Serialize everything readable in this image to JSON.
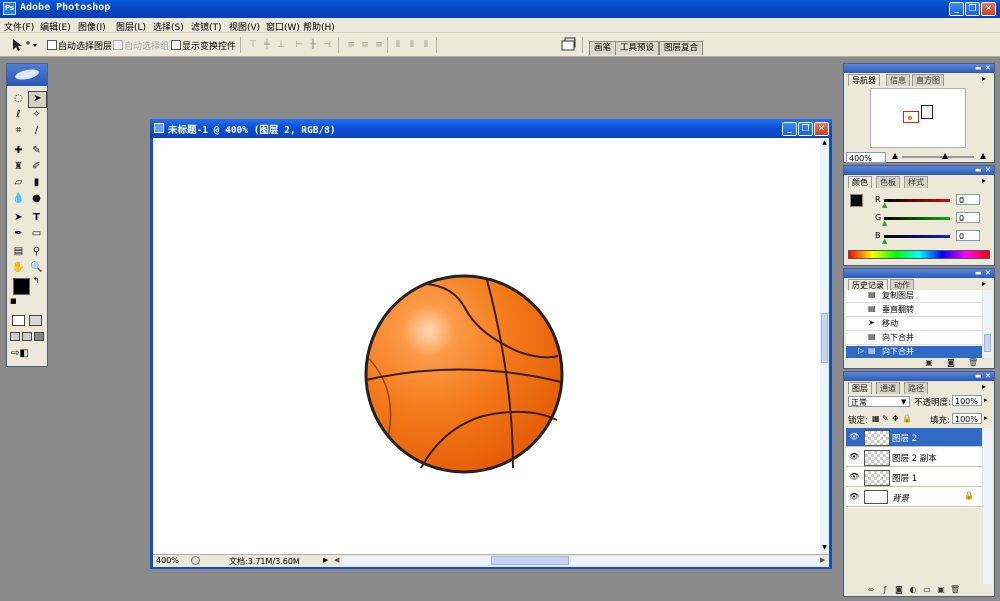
{
  "app": {
    "title": "Adobe Photoshop",
    "logo_text": "Ps"
  },
  "window_buttons": {
    "minimize": "_",
    "restore": "❐",
    "close": "✕"
  },
  "menu": [
    "文件(F)",
    "编辑(E)",
    "图像(I)",
    "图层(L)",
    "选择(S)",
    "滤镜(T)",
    "视图(V)",
    "窗口(W)",
    "帮助(H)"
  ],
  "options": {
    "auto_select_layer": "自动选择图层",
    "auto_select_group": "自动选择组",
    "show_transform": "显示变换控件",
    "dock_tabs": [
      "画笔",
      "工具预设",
      "图层复合"
    ]
  },
  "document": {
    "title": "未标题-1 @ 400% (图层 2, RGB/8)",
    "zoom": "400%",
    "doc_size": "文档:3.71M/3.60M"
  },
  "navigator": {
    "tabs": [
      "导航器",
      "信息",
      "直方图"
    ],
    "zoom": "400%"
  },
  "color": {
    "tabs": [
      "颜色",
      "色板",
      "样式"
    ],
    "channels": [
      {
        "label": "R",
        "value": "0",
        "color": "#cc1111"
      },
      {
        "label": "G",
        "value": "0",
        "color": "#11aa11"
      },
      {
        "label": "B",
        "value": "0",
        "color": "#1122cc"
      }
    ]
  },
  "history": {
    "tabs": [
      "历史记录",
      "动作"
    ],
    "items": [
      "复制图层",
      "垂直翻转",
      "移动",
      "向下合并",
      "向下合并"
    ]
  },
  "layers": {
    "tabs": [
      "图层",
      "通道",
      "路径"
    ],
    "blend_mode": "正常",
    "opacity_label": "不透明度:",
    "opacity": "100%",
    "lock_label": "锁定:",
    "fill_label": "填充:",
    "fill": "100%",
    "items": [
      "图层 2",
      "图层 2 副本",
      "图层 1",
      "背景"
    ]
  },
  "colors": {
    "title_blue": "#0a4fd0",
    "panel_bg": "#ece9d8",
    "workspace": "#8a8a8a",
    "selection": "#316ac5",
    "ball_orange": "#f47a1a"
  }
}
